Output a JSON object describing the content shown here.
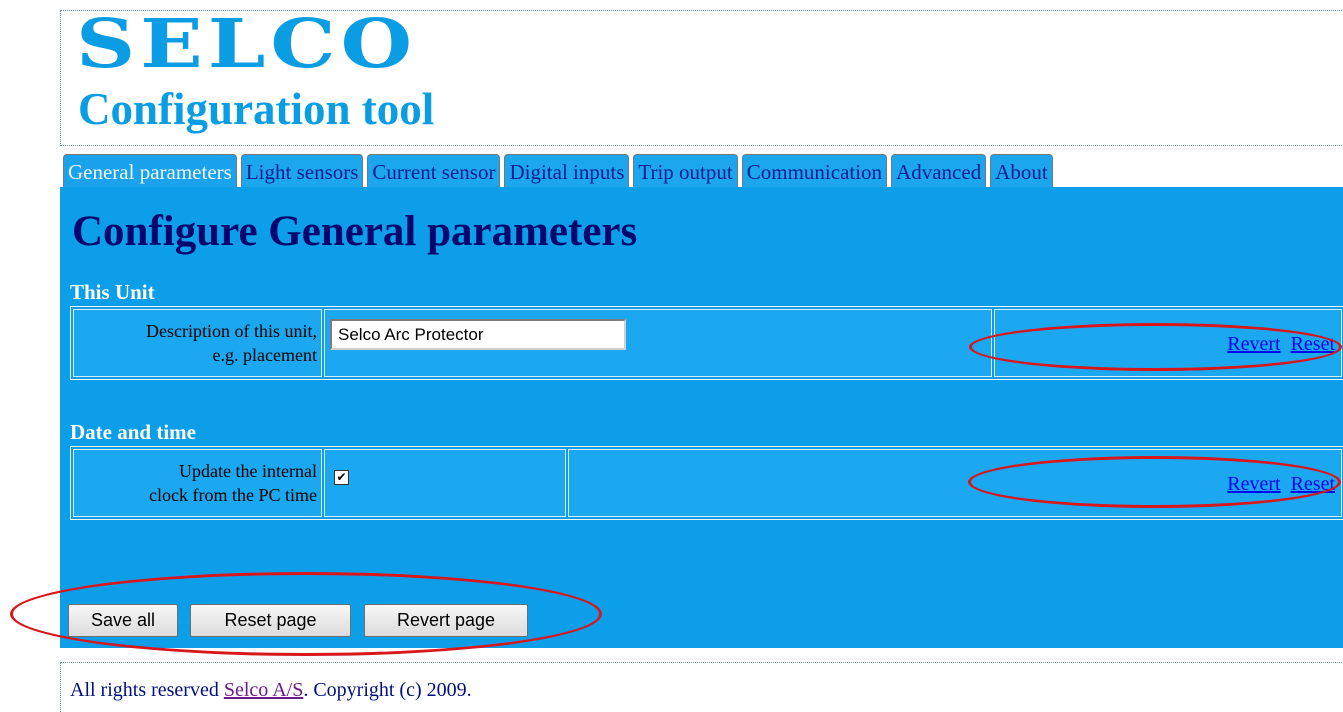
{
  "app": {
    "logo_text": "SELCO",
    "title": "Configuration tool"
  },
  "tabs": [
    {
      "label": "General parameters",
      "active": true
    },
    {
      "label": "Light sensors"
    },
    {
      "label": "Current sensor"
    },
    {
      "label": "Digital inputs"
    },
    {
      "label": "Trip output"
    },
    {
      "label": "Communication"
    },
    {
      "label": "Advanced"
    },
    {
      "label": "About"
    }
  ],
  "page": {
    "title": "Configure General parameters"
  },
  "this_unit": {
    "heading": "This Unit",
    "label_line1": "Description of this unit,",
    "label_line2": "e.g. placement",
    "value": "Selco Arc Protector",
    "revert": "Revert",
    "reset": "Reset"
  },
  "date_time": {
    "heading": "Date and time",
    "label_line1": "Update the internal",
    "label_line2": "clock from the PC time",
    "checked": true,
    "check_glyph": "✔",
    "revert": "Revert",
    "reset": "Reset"
  },
  "buttons": {
    "save_all": "Save all",
    "reset_page": "Reset page",
    "revert_page": "Revert page"
  },
  "footer": {
    "prefix": "All rights reserved ",
    "company": "Selco A/S",
    "suffix": ". Copyright (c) 2009."
  },
  "colors": {
    "brand": "#0b9de3",
    "panel": "#0c9ee9",
    "title": "#00066f",
    "annotation": "#d9161a"
  }
}
